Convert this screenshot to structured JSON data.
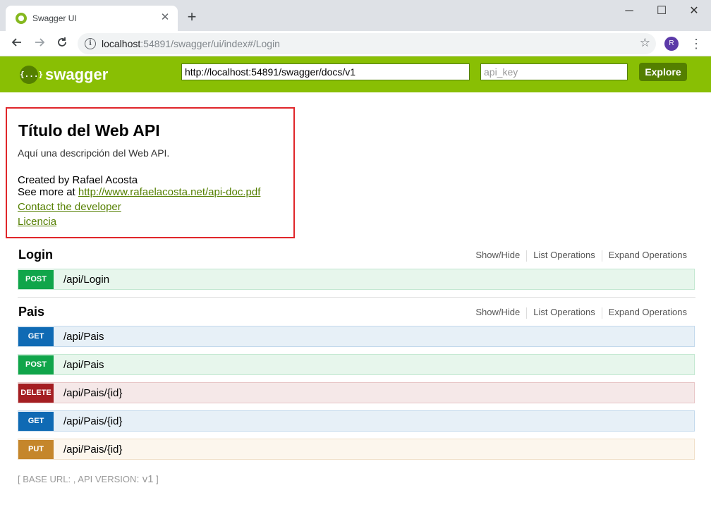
{
  "browser": {
    "tab_title": "Swagger UI",
    "tab_close": "✕",
    "new_tab": "+",
    "url_host": "localhost",
    "url_rest": ":54891/swagger/ui/index#/Login",
    "avatar_letter": "R",
    "window_controls": {
      "minimize": "─",
      "maximize": "☐",
      "close": "✕"
    },
    "icons": [
      "back-arrow-icon",
      "forward-arrow-icon",
      "reload-icon",
      "info-icon",
      "star-icon",
      "kebab-menu-icon"
    ]
  },
  "swagger_header": {
    "logo_glyph": "{...}",
    "name": "swagger",
    "spec_url": "http://localhost:54891/swagger/docs/v1",
    "api_key_placeholder": "api_key",
    "explore_label": "Explore",
    "colors": {
      "header_bg": "#89bf04",
      "accent": "#547f00"
    }
  },
  "info": {
    "title": "Título del Web API",
    "description": "Aquí una descripción del Web API.",
    "created_by": "Created by Rafael Acosta",
    "see_more_prefix": "See more at ",
    "see_more_link": "http://www.rafaelacosta.net/api-doc.pdf",
    "contact": "Contact the developer",
    "license": "Licencia"
  },
  "resource_actions": {
    "show_hide": "Show/Hide",
    "list_operations": "List Operations",
    "expand_operations": "Expand Operations"
  },
  "resources": [
    {
      "name": "Login",
      "operations": [
        {
          "method": "POST",
          "path": "/api/Login"
        }
      ]
    },
    {
      "name": "Pais",
      "operations": [
        {
          "method": "GET",
          "path": "/api/Pais"
        },
        {
          "method": "POST",
          "path": "/api/Pais"
        },
        {
          "method": "DELETE",
          "path": "/api/Pais/{id}"
        },
        {
          "method": "GET",
          "path": "/api/Pais/{id}"
        },
        {
          "method": "PUT",
          "path": "/api/Pais/{id}"
        }
      ]
    }
  ],
  "footer": {
    "open": "[ ",
    "base_url_label": "BASE URL",
    "base_url_value": ": ",
    "sep": ", ",
    "api_version_label": "API VERSION",
    "api_version_value": ": v1",
    "close": " ]"
  }
}
